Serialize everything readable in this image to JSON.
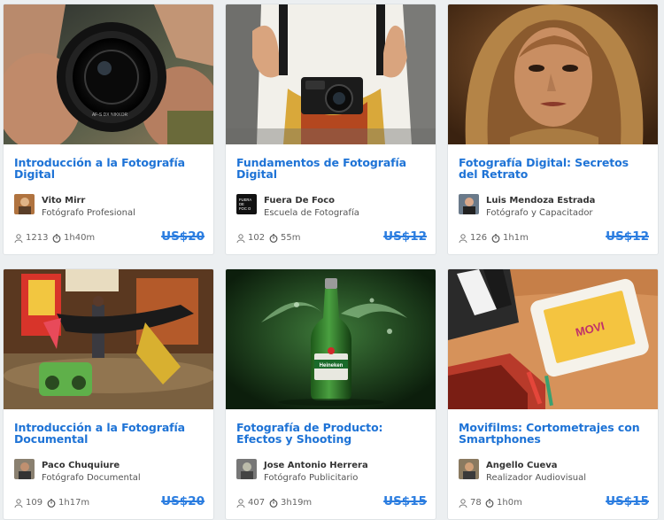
{
  "courses": [
    {
      "title": "Introducción a la Fotografía Digital",
      "author": "Vito Mirr",
      "role": "Fotógrafo Profesional",
      "students": "1213",
      "duration": "1h40m",
      "price": "US$20",
      "image": "camera-lens-photographer",
      "avatar_badge": "",
      "avatar_badge_text": ""
    },
    {
      "title": "Fundamentos de Fotografía Digital",
      "author": "Fuera De Foco",
      "role": "Escuela de Fotografía",
      "students": "102",
      "duration": "55m",
      "price": "US$12",
      "image": "camera-strap-chest",
      "avatar_badge": "logo",
      "avatar_badge_text": "FUERA DE FOC O"
    },
    {
      "title": "Fotografía Digital: Secretos del Retrato",
      "author": "Luis Mendoza Estrada",
      "role": "Fotógrafo y Capacitador",
      "students": "126",
      "duration": "1h1m",
      "price": "US$12",
      "image": "portrait-woman-scarf",
      "avatar_badge": "",
      "avatar_badge_text": ""
    },
    {
      "title": "Introducción a la Fotografía Documental",
      "author": "Paco Chuquiure",
      "role": "Fotógrafo Documental",
      "students": "109",
      "duration": "1h17m",
      "price": "US$20",
      "image": "street-dancer-boombox",
      "avatar_badge": "",
      "avatar_badge_text": ""
    },
    {
      "title": "Fotografía de Producto: Efectos y Shooting",
      "author": "Jose Antonio Herrera",
      "role": "Fotógrafo Publicitario",
      "students": "407",
      "duration": "3h19m",
      "price": "US$15",
      "image": "heineken-bottle-splash",
      "avatar_badge": "",
      "avatar_badge_text": ""
    },
    {
      "title": "Movifilms: Cortometrajes con Smartphones",
      "author": "Angello Cueva",
      "role": "Realizador Audiovisual",
      "students": "78",
      "duration": "1h0m",
      "price": "US$15",
      "image": "clapperboard-phone",
      "avatar_badge": "",
      "avatar_badge_text": ""
    }
  ],
  "images": {
    "bottle_label": "Heineken",
    "phone_text": "MOVI",
    "lens_text": "AF-S DX NIKKOR"
  },
  "icons": {
    "students": "user-icon",
    "duration": "stopwatch-icon"
  },
  "colors": {
    "accent": "#1e73d6",
    "price": "#2b7de0",
    "background": "#eceff1"
  }
}
